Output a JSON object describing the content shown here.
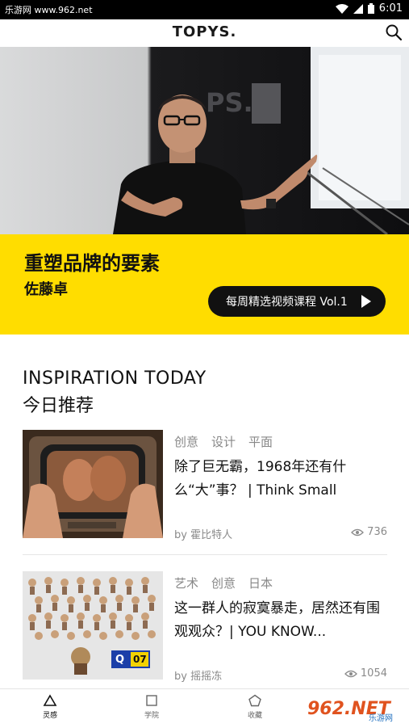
{
  "status_bar": {
    "carrier_watermark": "乐游网 www.962.net",
    "time": "6:01"
  },
  "header": {
    "logo": "TOPYS.",
    "search_icon": "search-icon"
  },
  "banner": {
    "title": "重塑品牌的要素",
    "speaker": "佐藤卓",
    "cta_label": "每周精选视频课程 Vol.1",
    "accent_color": "#FFDD00"
  },
  "section": {
    "title_en": "INSPIRATION TODAY",
    "title_cn": "今日推荐"
  },
  "articles": [
    {
      "tags": [
        "创意",
        "设计",
        "平面"
      ],
      "title": "除了巨无霸，1968年还有什么“大”事？ | Think Small",
      "author": "by 霍比特人",
      "views": "736"
    },
    {
      "tags": [
        "艺术",
        "创意",
        "日本"
      ],
      "title": "这一群人的寂寞暴走，居然还有围观观众？| YOU KNOW...",
      "author": "by 摇摇冻",
      "views": "1054",
      "badge_letter": "Q",
      "badge_number": "07"
    }
  ],
  "bottom_nav": {
    "items": [
      {
        "label": "灵感",
        "icon": "triangle-icon",
        "active": true
      },
      {
        "label": "学院",
        "icon": "square-icon",
        "active": false
      },
      {
        "label": "收藏",
        "icon": "pentagon-icon",
        "active": false
      }
    ]
  },
  "watermark": {
    "text": "962.NET",
    "subtext": "乐游网"
  }
}
